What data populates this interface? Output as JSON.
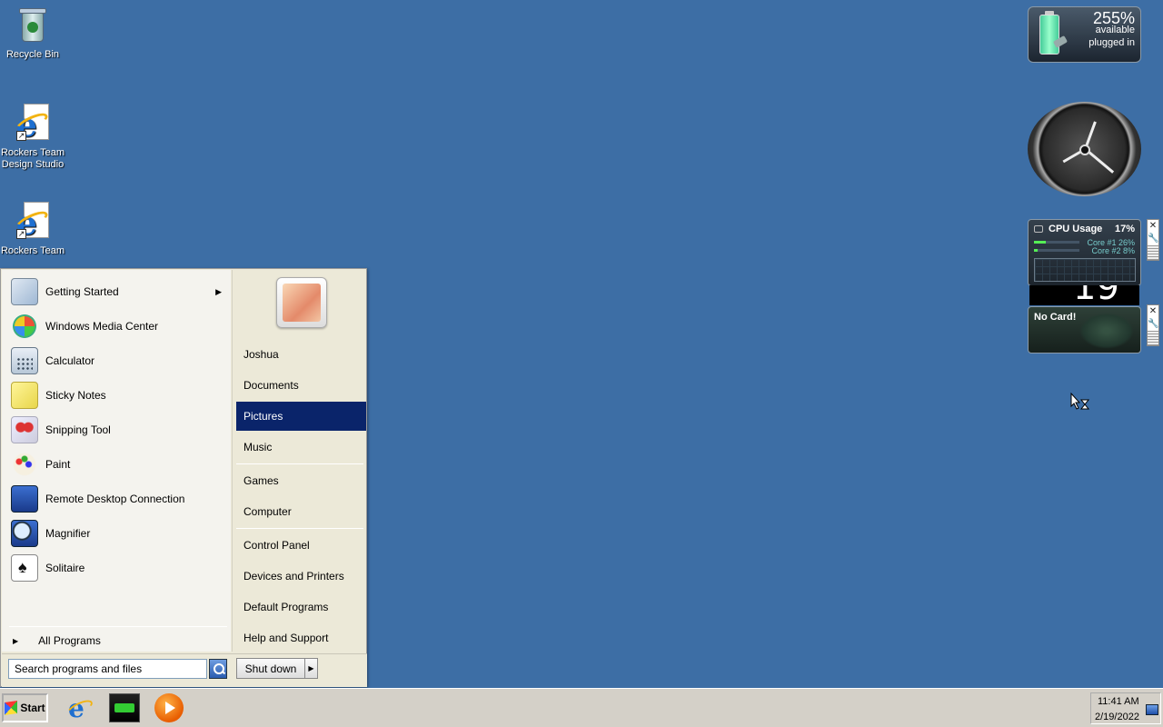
{
  "desktop": {
    "icons": [
      {
        "label": "Recycle Bin",
        "icon": "recycle-bin-icon"
      },
      {
        "label": "Rockers Team Design Studio",
        "icon": "internet-explorer-icon"
      },
      {
        "label": "Rockers Team",
        "icon": "internet-explorer-icon"
      }
    ]
  },
  "gadgets": {
    "battery": {
      "percent": "255%",
      "available": "available",
      "status": "plugged in"
    },
    "cpu": {
      "title": "CPU Usage",
      "total": "17%",
      "core1": "Core #1  26%",
      "core2": "Core #2   8%",
      "core1_value": 26,
      "core2_value": 8
    },
    "dark_digit": "19",
    "gpu": {
      "label": "No Card!"
    },
    "side_close": "✕",
    "side_wrench": "🔧"
  },
  "start_menu": {
    "programs": [
      {
        "label": "Getting Started",
        "has_submenu": true
      },
      {
        "label": "Windows Media Center"
      },
      {
        "label": "Calculator"
      },
      {
        "label": "Sticky Notes"
      },
      {
        "label": "Snipping Tool"
      },
      {
        "label": "Paint"
      },
      {
        "label": "Remote Desktop Connection"
      },
      {
        "label": "Magnifier"
      },
      {
        "label": "Solitaire"
      }
    ],
    "all_programs": "All Programs",
    "submenu_arrow": "▶",
    "places": [
      {
        "label": "Joshua"
      },
      {
        "label": "Documents"
      },
      {
        "label": "Pictures",
        "selected": true
      },
      {
        "label": "Music"
      },
      {
        "label": "Games"
      },
      {
        "label": "Computer"
      },
      {
        "label": "Control Panel"
      },
      {
        "label": "Devices and Printers"
      },
      {
        "label": "Default Programs"
      },
      {
        "label": "Help and Support"
      }
    ],
    "search_placeholder": "Search programs and files",
    "shutdown_label": "Shut down",
    "shutdown_arrow": "▶"
  },
  "taskbar": {
    "start_label": "Start",
    "time": "11:41 AM",
    "date": "2/19/2022"
  }
}
